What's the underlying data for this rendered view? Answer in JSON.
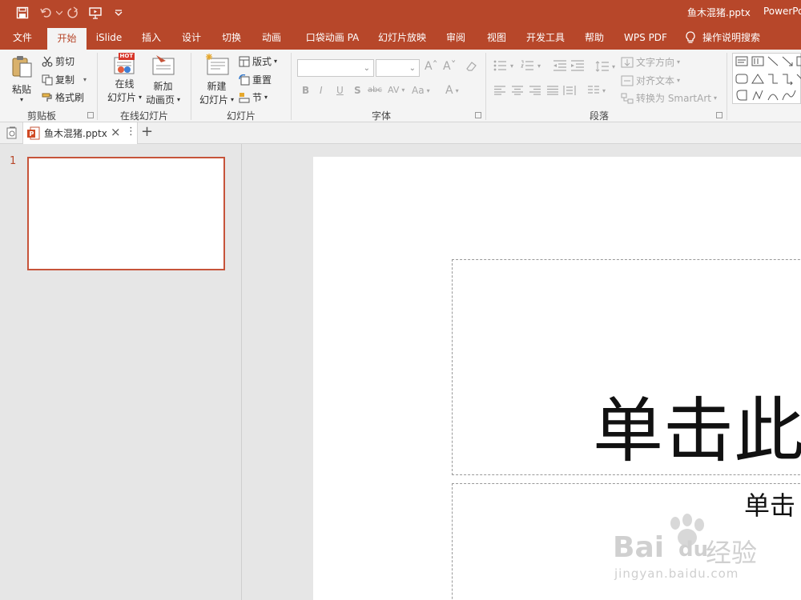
{
  "titlebar": {
    "filename": "鱼木混猪.pptx",
    "app_name": "PowerPo"
  },
  "menu": {
    "tabs": [
      "文件",
      "开始",
      "iSlide",
      "插入",
      "设计",
      "切换",
      "动画",
      "口袋动画 PA",
      "幻灯片放映",
      "审阅",
      "视图",
      "开发工具",
      "帮助",
      "WPS PDF"
    ],
    "active_tab": "开始",
    "tell_me": "操作说明搜索"
  },
  "ribbon": {
    "clipboard": {
      "paste": "粘贴",
      "cut": "剪切",
      "copy": "复制",
      "format_painter": "格式刷",
      "group": "剪贴板"
    },
    "online_slides": {
      "online": "在线",
      "online2": "幻灯片",
      "newpage": "新加",
      "newpage2": "动画页",
      "group": "在线幻灯片",
      "hot_badge": "HOT"
    },
    "slides": {
      "new": "新建",
      "new2": "幻灯片",
      "layout": "版式",
      "reset": "重置",
      "section": "节",
      "group": "幻灯片"
    },
    "font": {
      "group": "字体",
      "bold": "B",
      "italic": "I",
      "underline": "U",
      "shadow": "S",
      "strike": "abc",
      "spacing": "AV",
      "case": "Aa",
      "color": "A"
    },
    "paragraph": {
      "text_direction": "文字方向",
      "align_text": "对齐文本",
      "smartart": "转换为 SmartArt",
      "group": "段落"
    }
  },
  "doctab": {
    "name": "鱼木混猪.pptx",
    "close": "×",
    "more": "⋮",
    "add": "+"
  },
  "thumbs": {
    "slide_number": "1"
  },
  "slide": {
    "title_placeholder": "单击此",
    "subtitle_placeholder": "单击"
  },
  "watermark": {
    "line1": "Bai",
    "line2": "du",
    "line3": "经验",
    "url": "jingyan.baidu.com"
  },
  "colors": {
    "accent": "#b7472a",
    "thumb_border": "#c6543a"
  }
}
